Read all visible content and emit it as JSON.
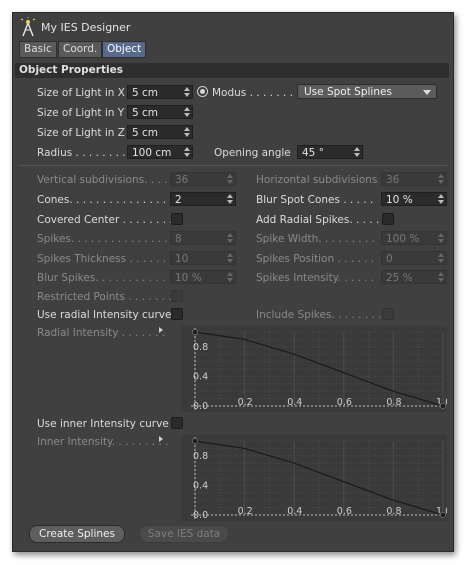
{
  "window": {
    "title": "My IES Designer",
    "icon": "light-tower-icon"
  },
  "tabs": [
    {
      "label": "Basic",
      "active": false
    },
    {
      "label": "Coord.",
      "active": false
    },
    {
      "label": "Object",
      "active": true
    }
  ],
  "section_title": "Object Properties",
  "size_x": {
    "label": "Size of Light in X",
    "value": "5 cm"
  },
  "size_y": {
    "label": "Size of Light in Y",
    "value": "5 cm"
  },
  "size_z": {
    "label": "Size of Light in Z",
    "value": "5 cm"
  },
  "modus": {
    "label": "Modus . . . . . . .",
    "value": "Use Spot Splines"
  },
  "radius": {
    "label": "Radius . . . . . . . .",
    "value": "100 cm"
  },
  "opening_angle": {
    "label": "Opening angle",
    "value": "45 °"
  },
  "vertical_subdivisions": {
    "label": "Vertical subdivisions. . . .",
    "value": "36"
  },
  "horizontal_subdivisions": {
    "label": "Horizontal subdivisions",
    "value": "36"
  },
  "cones": {
    "label": "Cones. . . . . . . . . . . . . . .",
    "value": "2"
  },
  "blur_spot_cones": {
    "label": "Blur Spot Cones . . . . .",
    "value": "10 %"
  },
  "covered_center": {
    "label": "Covered Center . . . . . . . ."
  },
  "add_radial_spikes": {
    "label": "Add Radial Spikes. . . . ."
  },
  "spikes": {
    "label": "Spikes. . . . . . . . . . . . . . .",
    "value": "8"
  },
  "spike_width": {
    "label": "Spike Width. . . . . . . . .",
    "value": "100 %"
  },
  "spikes_thickness": {
    "label": "Spikes Thickness . . . . . .",
    "value": "10"
  },
  "spikes_position": {
    "label": "Spikes Position . . . . . .",
    "value": "0"
  },
  "blur_spikes": {
    "label": "Blur Spikes. . . . . . . . . . .",
    "value": "10 %"
  },
  "spikes_intensity": {
    "label": "Spikes Intensity. . . . . .",
    "value": "25 %"
  },
  "restricted_points": {
    "label": "Restricted Points . . . . . . ."
  },
  "use_radial_curve": {
    "label": "Use radial Intensity curve"
  },
  "include_spikes": {
    "label": "Include Spikes. . . . . . . . ."
  },
  "radial_intensity": {
    "label": "Radial Intensity . . . . . . ."
  },
  "use_inner_curve": {
    "label": "Use inner Intensity curve"
  },
  "inner_intensity": {
    "label": "Inner Intensity. . . . . . . . ."
  },
  "graph_axis": {
    "y_ticks": [
      "0.8",
      "0.4",
      "0.0"
    ],
    "x_ticks": [
      "0.2",
      "0.4",
      "0.6",
      "0.8",
      "1.0"
    ]
  },
  "chart_data": [
    {
      "type": "line",
      "title": "",
      "x": [
        0.0,
        0.2,
        0.4,
        0.6,
        0.8,
        1.0
      ],
      "series": [
        {
          "values": [
            1.0,
            0.9,
            0.7,
            0.45,
            0.2,
            0.0
          ]
        }
      ],
      "xlim": [
        0,
        1
      ],
      "ylim": [
        0,
        1
      ]
    },
    {
      "type": "line",
      "title": "",
      "x": [
        0.0,
        0.2,
        0.4,
        0.6,
        0.8,
        1.0
      ],
      "series": [
        {
          "values": [
            1.0,
            0.9,
            0.7,
            0.45,
            0.2,
            0.0
          ]
        }
      ],
      "xlim": [
        0,
        1
      ],
      "ylim": [
        0,
        1
      ]
    }
  ],
  "buttons": {
    "create_splines": {
      "label": "Create Splines",
      "enabled": true
    },
    "save_ies": {
      "label": "Save IES data",
      "enabled": false
    }
  }
}
